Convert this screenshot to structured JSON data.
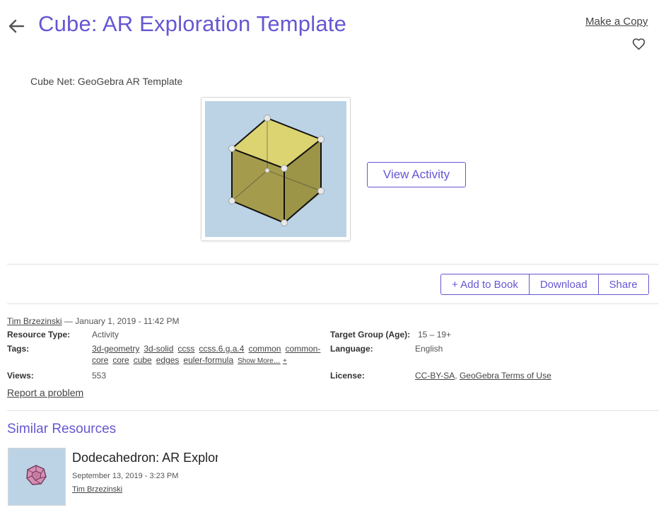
{
  "header": {
    "title": "Cube: AR Exploration Template",
    "make_copy": "Make a Copy"
  },
  "activity": {
    "subtitle": "Cube Net: GeoGebra AR Template",
    "view_button": "View Activity"
  },
  "actions": {
    "add_to_book": "+ Add to Book",
    "download": "Download",
    "share": "Share"
  },
  "meta": {
    "author": "Tim Brzezinski",
    "date": "— January 1, 2019 - 11:42 PM",
    "resource_type_label": "Resource Type:",
    "resource_type": "Activity",
    "tags_label": "Tags:",
    "tags": [
      "3d-geometry",
      "3d-solid",
      "ccss",
      "ccss.6.g.a.4",
      "common",
      "common-core",
      "core",
      "cube",
      "edges",
      "euler-formula"
    ],
    "show_more": "Show More…",
    "show_more_plus": "+",
    "views_label": "Views:",
    "views": "553",
    "target_label": "Target Group (Age):",
    "target": "15 – 19+",
    "language_label": "Language:",
    "language": "English",
    "license_label": "License:",
    "license_1": "CC-BY-SA",
    "license_sep": ",",
    "license_2": "GeoGebra Terms of Use",
    "report": "Report a problem"
  },
  "similar": {
    "heading": "Similar Resources",
    "items": [
      {
        "title": "Dodecahedron: AR Explor",
        "date": "September 13, 2019 - 3:23 PM",
        "author": "Tim Brzezinski"
      }
    ]
  },
  "icons": {
    "back": "arrow-left-icon",
    "favorite": "heart-outline-icon"
  },
  "colors": {
    "accent": "#6557d2",
    "thumb_bg": "#bcd3e6",
    "cube_face": "#d9d06a"
  }
}
